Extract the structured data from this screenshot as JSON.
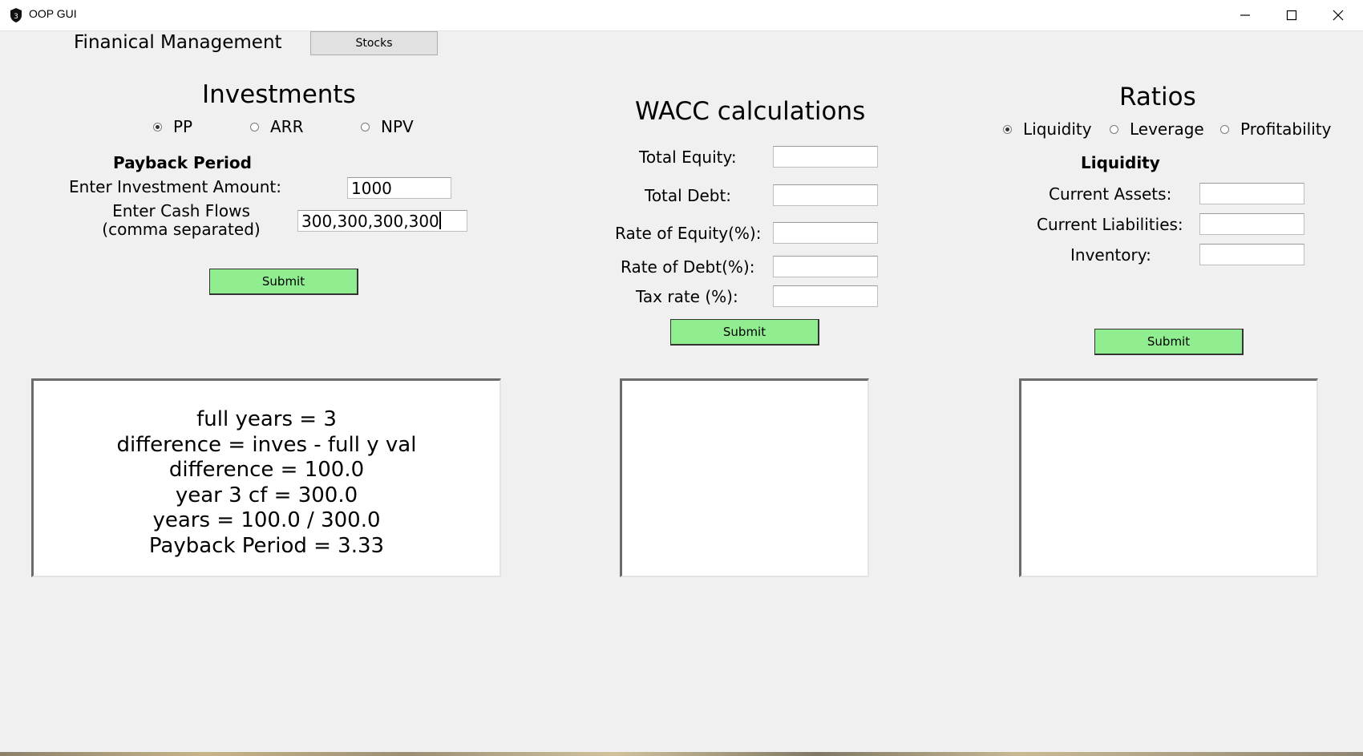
{
  "window": {
    "title": "OOP GUI",
    "app_icon": "shield-icon",
    "controls": [
      "minimize-icon",
      "maximize-icon",
      "close-icon"
    ]
  },
  "header": {
    "title": "Finanical Management",
    "stocks_button": "Stocks"
  },
  "investments": {
    "title": "Investments",
    "options": [
      {
        "label": "PP",
        "selected": true
      },
      {
        "label": "ARR",
        "selected": false
      },
      {
        "label": "NPV",
        "selected": false
      }
    ],
    "subtitle": "Payback Period",
    "investment_label": "Enter Investment Amount:",
    "investment_value": "1000",
    "cashflow_label_line1": "Enter Cash Flows",
    "cashflow_label_line2": "(comma separated)",
    "cashflow_value": "300,300,300,300",
    "submit_label": "Submit",
    "output_lines": "full years = 3\ndifference = inves - full y val\ndifference = 100.0\nyear 3 cf = 300.0\nyears = 100.0 / 300.0\nPayback Period = 3.33"
  },
  "wacc": {
    "title": "WACC calculations",
    "fields": [
      {
        "label": "Total Equity:",
        "value": ""
      },
      {
        "label": "Total Debt:",
        "value": ""
      },
      {
        "label": "Rate of Equity(%):",
        "value": ""
      },
      {
        "label": "Rate of Debt(%):",
        "value": ""
      },
      {
        "label": "Tax rate (%):",
        "value": ""
      }
    ],
    "submit_label": "Submit",
    "output_lines": ""
  },
  "ratios": {
    "title": "Ratios",
    "options": [
      {
        "label": "Liquidity",
        "selected": true
      },
      {
        "label": "Leverage",
        "selected": false
      },
      {
        "label": "Profitability",
        "selected": false
      }
    ],
    "subtitle": "Liquidity",
    "fields": [
      {
        "label": "Current Assets:",
        "value": ""
      },
      {
        "label": "Current Liabilities:",
        "value": ""
      },
      {
        "label": "Inventory:",
        "value": ""
      }
    ],
    "submit_label": "Submit",
    "output_lines": ""
  },
  "colors": {
    "background": "#f0f0f0",
    "submit_button": "#90ee90",
    "stocks_button": "#e1e1e1"
  }
}
